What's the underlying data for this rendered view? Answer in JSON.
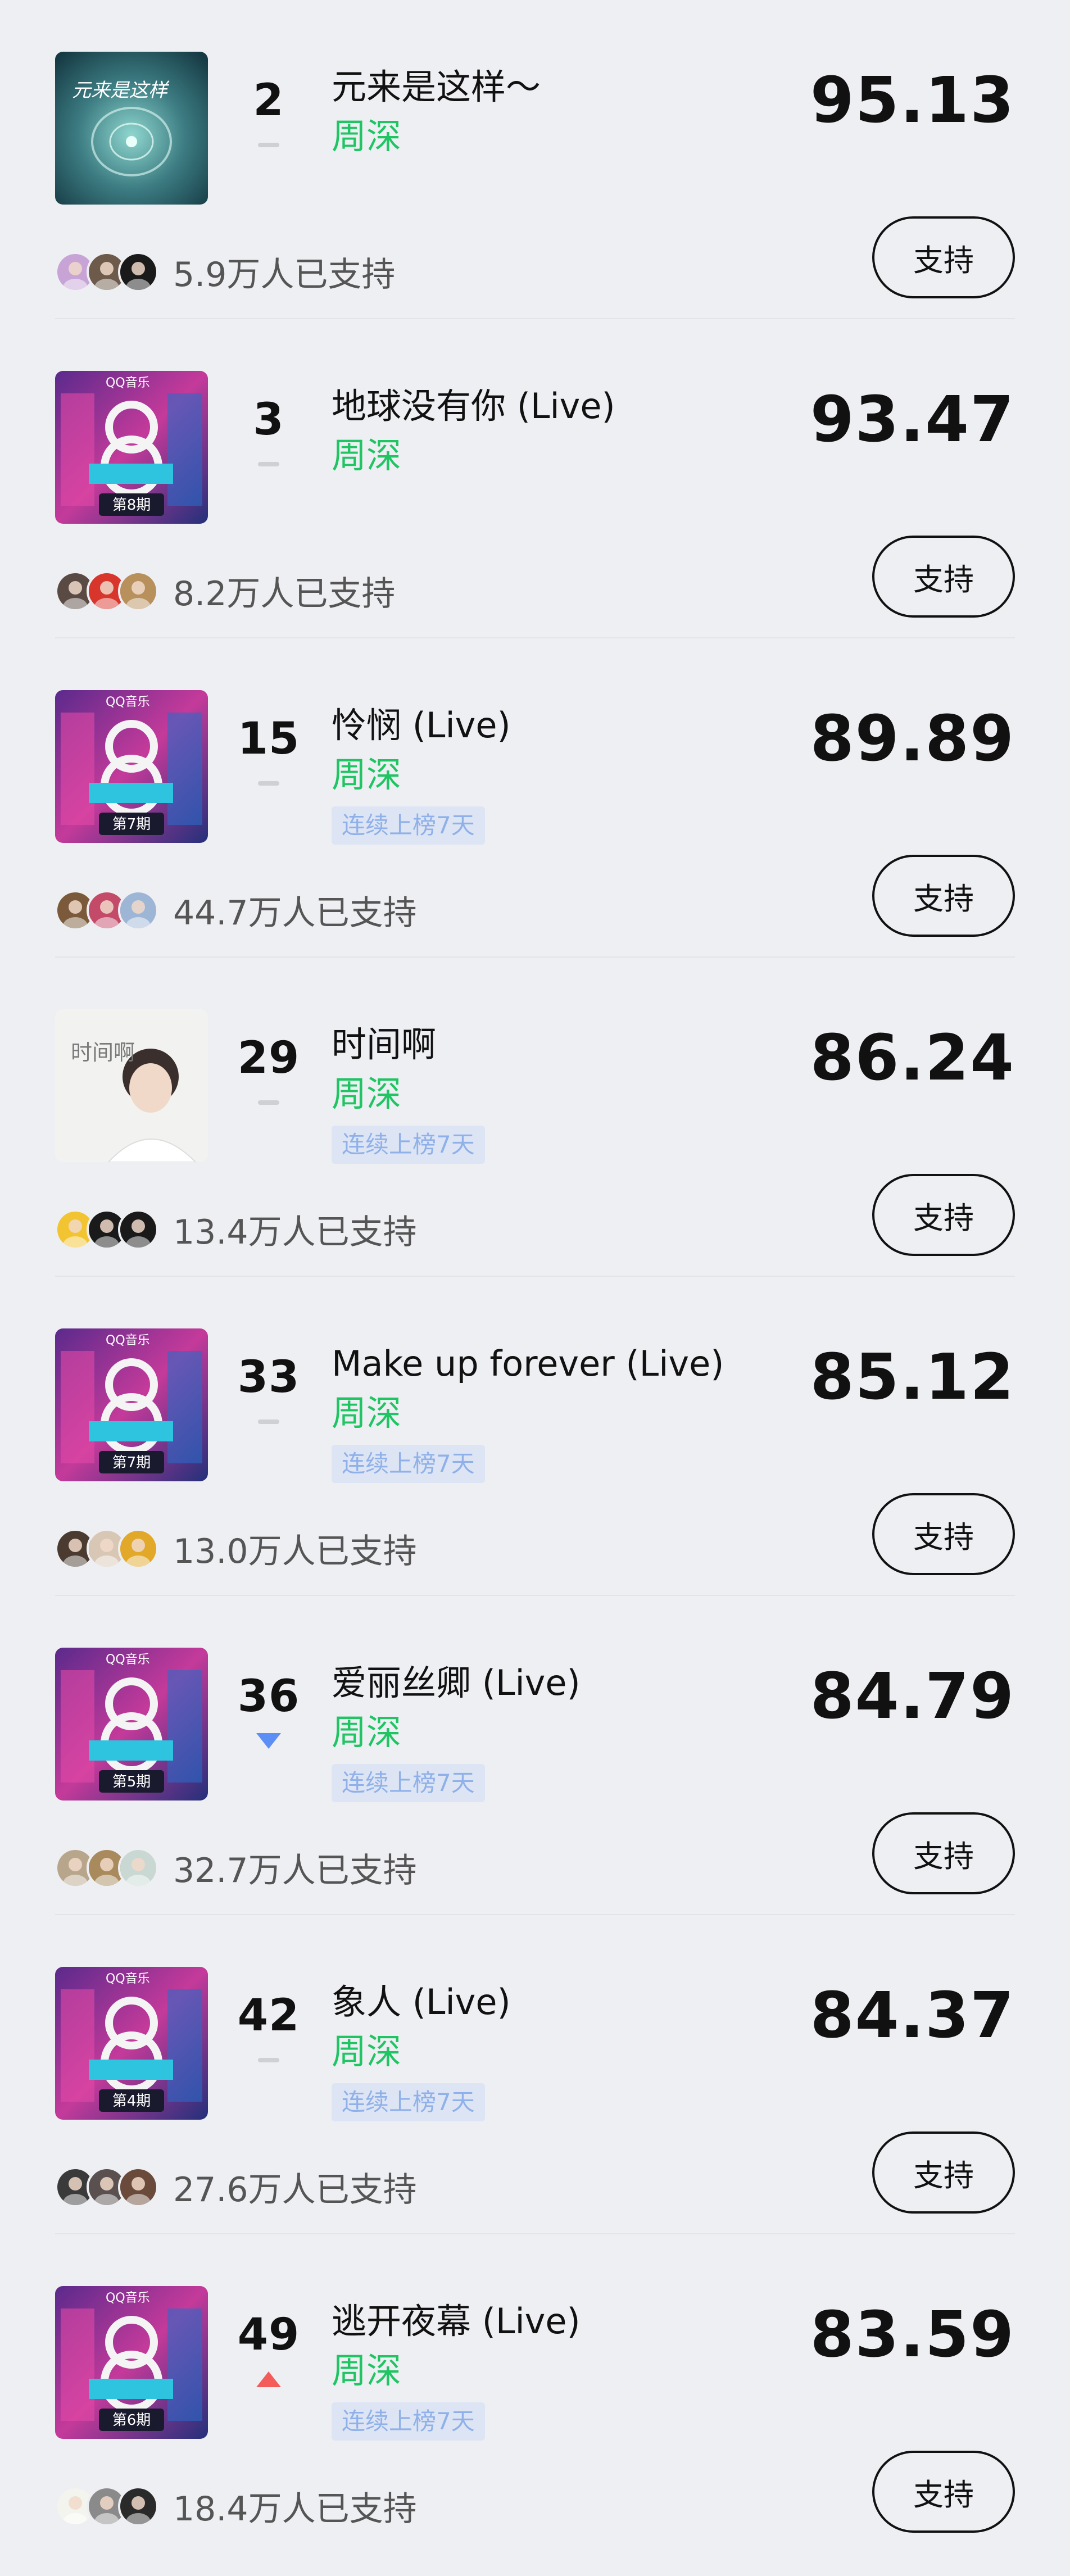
{
  "support_label": "支持",
  "rows": [
    {
      "rank": "2",
      "trend": "flat",
      "song": "元来是这样～",
      "artist": "周深",
      "streak": "",
      "score": "95.13",
      "supporters": "5.9万人已支持",
      "cover": "teal",
      "avatars": [
        "#c7a3d6",
        "#6d5a4a",
        "#1a1a1a"
      ]
    },
    {
      "rank": "3",
      "trend": "flat",
      "song": "地球没有你 (Live)",
      "artist": "周深",
      "streak": "",
      "score": "93.47",
      "supporters": "8.2万人已支持",
      "cover": "show",
      "issue": "第8期",
      "avatars": [
        "#5a4a44",
        "#d8362c",
        "#b8905c"
      ]
    },
    {
      "rank": "15",
      "trend": "flat",
      "song": "怜悯 (Live)",
      "artist": "周深",
      "streak": "连续上榜7天",
      "score": "89.89",
      "supporters": "44.7万人已支持",
      "cover": "show",
      "issue": "第7期",
      "avatars": [
        "#7a5a3a",
        "#c44a6a",
        "#9eb6d6"
      ]
    },
    {
      "rank": "29",
      "trend": "flat",
      "song": "时间啊",
      "artist": "周深",
      "streak": "连续上榜7天",
      "score": "86.24",
      "supporters": "13.4万人已支持",
      "cover": "white",
      "avatars": [
        "#f2c431",
        "#1a1a1a",
        "#1a1a1a"
      ]
    },
    {
      "rank": "33",
      "trend": "flat",
      "song": "Make up forever (Live)",
      "artist": "周深",
      "streak": "连续上榜7天",
      "score": "85.12",
      "supporters": "13.0万人已支持",
      "cover": "show",
      "issue": "第7期",
      "avatars": [
        "#4a3a30",
        "#d9c7b6",
        "#e1a82a"
      ]
    },
    {
      "rank": "36",
      "trend": "down",
      "song": "爱丽丝卿 (Live)",
      "artist": "周深",
      "streak": "连续上榜7天",
      "score": "84.79",
      "supporters": "32.7万人已支持",
      "cover": "show",
      "issue": "第5期",
      "avatars": [
        "#b8a68c",
        "#a88a5c",
        "#c9d8d3"
      ]
    },
    {
      "rank": "42",
      "trend": "flat",
      "song": "象人 (Live)",
      "artist": "周深",
      "streak": "连续上榜7天",
      "score": "84.37",
      "supporters": "27.6万人已支持",
      "cover": "show",
      "issue": "第4期",
      "avatars": [
        "#3a3a3a",
        "#5a5050",
        "#6a4a3a"
      ]
    },
    {
      "rank": "49",
      "trend": "up",
      "song": "逃开夜幕 (Live)",
      "artist": "周深",
      "streak": "连续上榜7天",
      "score": "83.59",
      "supporters": "18.4万人已支持",
      "cover": "show",
      "issue": "第6期",
      "avatars": [
        "#f4f4ee",
        "#8a8a8a",
        "#2a2a2a"
      ]
    }
  ],
  "covers": {
    "teal_title": "元来是这样",
    "white_title": "时间啊",
    "show_brand": "QQ音乐"
  },
  "colors": {
    "accent_green": "#1fc463",
    "trend_down": "#5b8ff6",
    "trend_up": "#f45c5c",
    "streak_bg": "#dde5f5",
    "streak_text": "#8fb0e8"
  }
}
